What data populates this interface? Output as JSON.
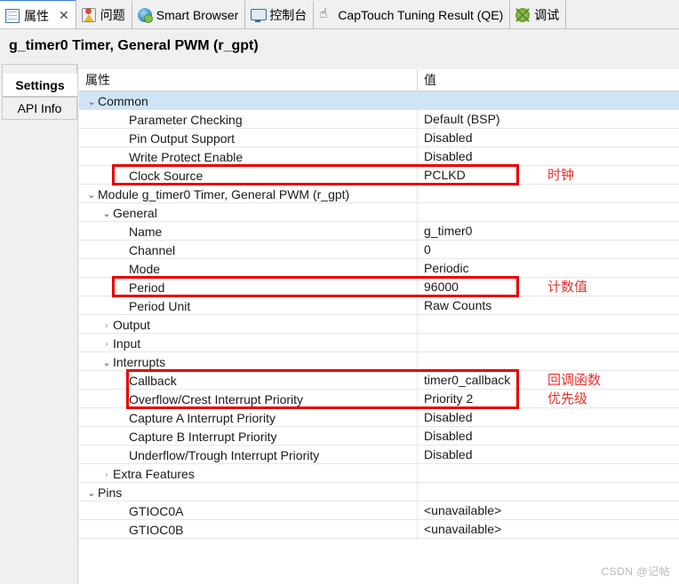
{
  "tabs": [
    {
      "label": "属性",
      "icon": "properties-icon",
      "active": true,
      "closable": true
    },
    {
      "label": "问题",
      "icon": "problems-icon",
      "active": false,
      "closable": false
    },
    {
      "label": "Smart Browser",
      "icon": "globe-icon",
      "active": false,
      "closable": false
    },
    {
      "label": "控制台",
      "icon": "console-icon",
      "active": false,
      "closable": false
    },
    {
      "label": "CapTouch Tuning Result (QE)",
      "icon": "hand-icon",
      "active": false,
      "closable": false
    },
    {
      "label": "调试",
      "icon": "bug-icon",
      "active": false,
      "closable": false
    }
  ],
  "close_glyph": "✕",
  "title": "g_timer0 Timer, General PWM (r_gpt)",
  "leftnav": {
    "items": [
      {
        "label": "Settings",
        "selected": true
      },
      {
        "label": "API Info",
        "selected": false
      }
    ]
  },
  "table": {
    "headers": {
      "name": "属性",
      "value": "值"
    },
    "twisty_expanded": "⌄",
    "twisty_collapsed": "›",
    "rows": [
      {
        "name": "Common",
        "value": "",
        "indent": 0,
        "twisty": "expanded",
        "highlight": true
      },
      {
        "name": "Parameter Checking",
        "value": "Default (BSP)",
        "indent": 2,
        "twisty": "none",
        "highlight": false
      },
      {
        "name": "Pin Output Support",
        "value": "Disabled",
        "indent": 2,
        "twisty": "none",
        "highlight": false
      },
      {
        "name": "Write Protect Enable",
        "value": "Disabled",
        "indent": 2,
        "twisty": "none",
        "highlight": false
      },
      {
        "name": "Clock Source",
        "value": "PCLKD",
        "indent": 2,
        "twisty": "none",
        "highlight": false
      },
      {
        "name": "Module g_timer0 Timer, General PWM (r_gpt)",
        "value": "",
        "indent": 0,
        "twisty": "expanded",
        "highlight": false
      },
      {
        "name": "General",
        "value": "",
        "indent": 1,
        "twisty": "expanded",
        "highlight": false
      },
      {
        "name": "Name",
        "value": "g_timer0",
        "indent": 2,
        "twisty": "none",
        "highlight": false
      },
      {
        "name": "Channel",
        "value": "0",
        "indent": 2,
        "twisty": "none",
        "highlight": false
      },
      {
        "name": "Mode",
        "value": "Periodic",
        "indent": 2,
        "twisty": "none",
        "highlight": false
      },
      {
        "name": "Period",
        "value": "96000",
        "indent": 2,
        "twisty": "none",
        "highlight": false
      },
      {
        "name": "Period Unit",
        "value": "Raw Counts",
        "indent": 2,
        "twisty": "none",
        "highlight": false
      },
      {
        "name": "Output",
        "value": "",
        "indent": 1,
        "twisty": "collapsed",
        "highlight": false
      },
      {
        "name": "Input",
        "value": "",
        "indent": 1,
        "twisty": "collapsed",
        "highlight": false
      },
      {
        "name": "Interrupts",
        "value": "",
        "indent": 1,
        "twisty": "expanded",
        "highlight": false
      },
      {
        "name": "Callback",
        "value": "timer0_callback",
        "indent": 2,
        "twisty": "none",
        "highlight": false
      },
      {
        "name": "Overflow/Crest Interrupt Priority",
        "value": "Priority 2",
        "indent": 2,
        "twisty": "none",
        "highlight": false
      },
      {
        "name": "Capture A Interrupt Priority",
        "value": "Disabled",
        "indent": 2,
        "twisty": "none",
        "highlight": false
      },
      {
        "name": "Capture B Interrupt Priority",
        "value": "Disabled",
        "indent": 2,
        "twisty": "none",
        "highlight": false
      },
      {
        "name": "Underflow/Trough Interrupt Priority",
        "value": "Disabled",
        "indent": 2,
        "twisty": "none",
        "highlight": false
      },
      {
        "name": "Extra Features",
        "value": "",
        "indent": 1,
        "twisty": "collapsed",
        "highlight": false
      },
      {
        "name": "Pins",
        "value": "",
        "indent": 0,
        "twisty": "expanded",
        "highlight": false
      },
      {
        "name": "GTIOC0A",
        "value": "<unavailable>",
        "indent": 2,
        "twisty": "none",
        "highlight": false
      },
      {
        "name": "GTIOC0B",
        "value": "<unavailable>",
        "indent": 2,
        "twisty": "none",
        "highlight": false
      }
    ]
  },
  "annotations": {
    "color": "#e8322d",
    "boxes": [
      {
        "name": "clock-source-highlight",
        "target_row": "Clock Source"
      },
      {
        "name": "period-highlight",
        "target_row": "Period"
      },
      {
        "name": "interrupts-highlight",
        "target_rows": "Callback / Overflow/Crest Interrupt Priority"
      }
    ],
    "labels": [
      {
        "text": "时钟",
        "for": "Clock Source"
      },
      {
        "text": "计数值",
        "for": "Period"
      },
      {
        "text": "回调函数",
        "for": "Callback"
      },
      {
        "text": "优先级",
        "for": "Overflow/Crest Interrupt Priority"
      }
    ]
  },
  "watermark": "CSDN @记帖"
}
